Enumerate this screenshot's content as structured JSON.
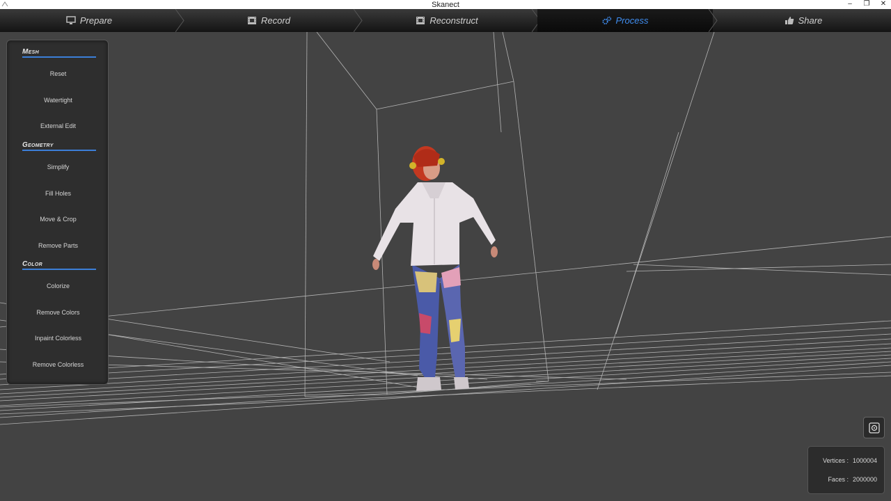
{
  "window": {
    "title": "Skanect",
    "controls": [
      "–",
      "❐",
      "✕"
    ]
  },
  "tabs": [
    {
      "label": "Prepare",
      "icon": "monitor-icon",
      "active": false
    },
    {
      "label": "Record",
      "icon": "film-icon",
      "active": false
    },
    {
      "label": "Reconstruct",
      "icon": "film-icon",
      "active": false
    },
    {
      "label": "Process",
      "icon": "gears-icon",
      "active": true
    },
    {
      "label": "Share",
      "icon": "thumbs-up-icon",
      "active": false
    }
  ],
  "panel": {
    "mesh": {
      "header": "Mesh",
      "items": [
        "Reset",
        "Watertight",
        "External Edit"
      ]
    },
    "geometry": {
      "header": "Geometry",
      "items": [
        "Simplify",
        "Fill Holes",
        "Move & Crop",
        "Remove Parts"
      ]
    },
    "color": {
      "header": "Color",
      "items": [
        "Colorize",
        "Remove Colors",
        "Inpaint Colorless",
        "Remove Colorless"
      ]
    }
  },
  "stats": {
    "vertices_label": "Vertices :",
    "vertices_value": "1000004",
    "faces_label": "Faces :",
    "faces_value": "2000000"
  },
  "colors": {
    "accent": "#3f8df0",
    "section_underline": "#3c7fd8",
    "viewport_bg": "#434343"
  }
}
